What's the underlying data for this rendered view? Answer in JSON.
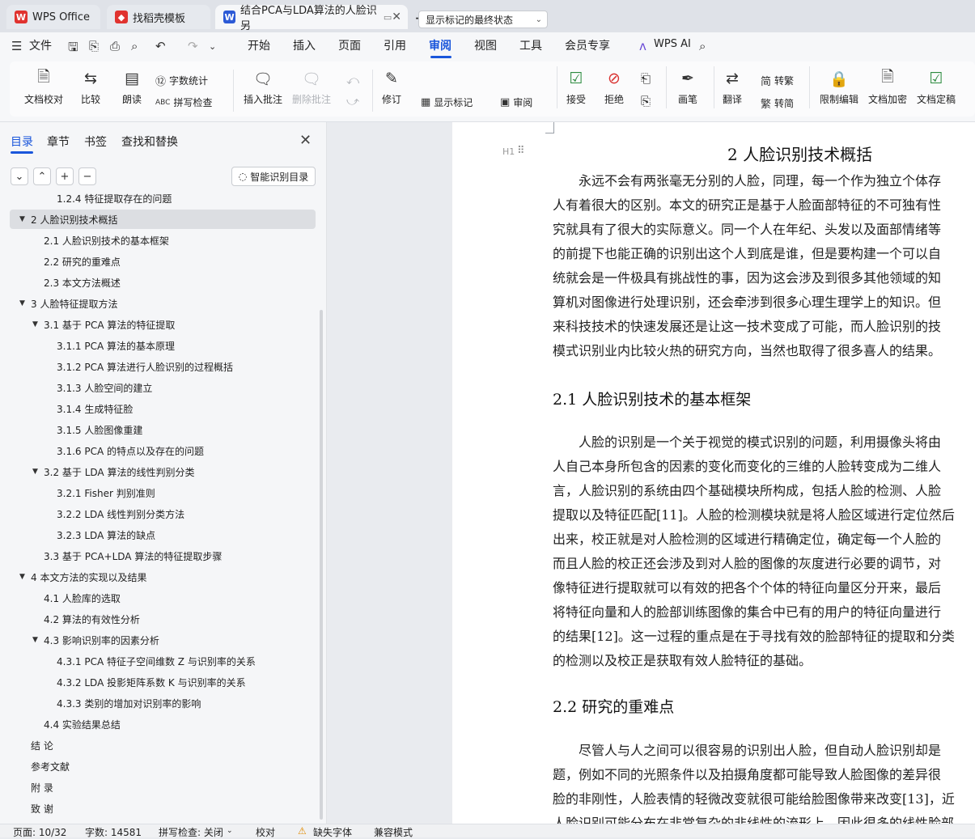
{
  "tabs": [
    {
      "label": "WPS Office",
      "icon": "wps-logo-icon",
      "color": "#e0332f"
    },
    {
      "label": "找稻壳模板",
      "icon": "docer-logo-icon",
      "color": "#e0332f"
    },
    {
      "label": "结合PCA与LDA算法的人脸识另",
      "icon": "word-doc-icon",
      "color": "#2c5ad6"
    }
  ],
  "menu": {
    "file": "文件",
    "items": [
      "开始",
      "插入",
      "页面",
      "引用",
      "审阅",
      "视图",
      "工具",
      "会员专享"
    ],
    "active": "审阅",
    "wps_ai": "WPS AI"
  },
  "ribbon": {
    "doc_check": "文档校对",
    "compare": "比较",
    "read_aloud": "朗读",
    "word_count": "字数统计",
    "spell_check": "拼写检查",
    "insert_comment": "插入批注",
    "delete_comment": "删除批注",
    "track": "修订",
    "markup_select": "显示标记的最终状态",
    "show_markup": "显示标记",
    "review_pane": "审阅",
    "accept": "接受",
    "reject": "拒绝",
    "pen": "画笔",
    "translate": "翻译",
    "to_traditional": "转繁",
    "to_simplified": "转简",
    "restrict_edit": "限制编辑",
    "doc_encrypt": "文档加密",
    "doc_finalize": "文档定稿"
  },
  "nav": {
    "tabs": [
      "目录",
      "章节",
      "书签",
      "查找和替换"
    ],
    "active_tab": "目录",
    "smart_toc": "智能识别目录",
    "toc": [
      {
        "text": "1.2.4  特征提取存在的问题",
        "level": 3,
        "caret": false
      },
      {
        "text": "2  人脸识别技术概括",
        "level": 1,
        "caret": true,
        "selected": true
      },
      {
        "text": "2.1  人脸识别技术的基本框架",
        "level": 2,
        "caret": false
      },
      {
        "text": "2.2  研究的重难点",
        "level": 2,
        "caret": false
      },
      {
        "text": "2.3  本文方法概述",
        "level": 2,
        "caret": false
      },
      {
        "text": "3  人脸特征提取方法",
        "level": 1,
        "caret": true
      },
      {
        "text": "3.1  基于 PCA 算法的特征提取",
        "level": 2,
        "caret": true
      },
      {
        "text": "3.1.1 PCA 算法的基本原理",
        "level": 3,
        "caret": false
      },
      {
        "text": "3.1.2 PCA 算法进行人脸识别的过程概括",
        "level": 3,
        "caret": false
      },
      {
        "text": "3.1.3  人脸空间的建立",
        "level": 3,
        "caret": false
      },
      {
        "text": "3.1.4  生成特征脸",
        "level": 3,
        "caret": false
      },
      {
        "text": "3.1.5  人脸图像重建",
        "level": 3,
        "caret": false
      },
      {
        "text": "3.1.6 PCA 的特点以及存在的问题",
        "level": 3,
        "caret": false
      },
      {
        "text": "3.2  基于 LDA 算法的线性判别分类",
        "level": 2,
        "caret": true
      },
      {
        "text": "3.2.1 Fisher 判别准则",
        "level": 3,
        "caret": false
      },
      {
        "text": "3.2.2 LDA 线性判别分类方法",
        "level": 3,
        "caret": false
      },
      {
        "text": "3.2.3 LDA 算法的缺点",
        "level": 3,
        "caret": false
      },
      {
        "text": "3.3  基于 PCA+LDA 算法的特征提取步骤",
        "level": 2,
        "caret": false
      },
      {
        "text": "4  本文方法的实现以及结果",
        "level": 1,
        "caret": true
      },
      {
        "text": "4.1  人脸库的选取",
        "level": 2,
        "caret": false
      },
      {
        "text": "4.2  算法的有效性分析",
        "level": 2,
        "caret": false
      },
      {
        "text": "4.3  影响识别率的因素分析",
        "level": 2,
        "caret": true
      },
      {
        "text": "4.3.1 PCA 特征子空间维数 Z 与识别率的关系",
        "level": 3,
        "caret": false
      },
      {
        "text": "4.3.2 LDA 投影矩阵系数 K 与识别率的关系",
        "level": 3,
        "caret": false
      },
      {
        "text": "4.3.3  类别的增加对识别率的影响",
        "level": 3,
        "caret": false
      },
      {
        "text": "4.4  实验结果总结",
        "level": 2,
        "caret": false
      },
      {
        "text": "结  论",
        "level": 1,
        "caret": false
      },
      {
        "text": "参考文献",
        "level": 1,
        "caret": false
      },
      {
        "text": "附  录",
        "level": 1,
        "caret": false
      },
      {
        "text": "致  谢",
        "level": 1,
        "caret": false
      }
    ]
  },
  "doc": {
    "heading_mark": "H1",
    "h1": "2  人脸识别技术概括",
    "p1": [
      "　　永远不会有两张毫无分别的人脸，同理，每一个作为独立个体存",
      "人有着很大的区别。本文的研究正是基于人脸面部特征的不可独有性",
      "究就具有了很大的实际意义。同一个人在年纪、头发以及面部情绪等",
      "的前提下也能正确的识别出这个人到底是谁，但是要构建一个可以自",
      "统就会是一件极具有挑战性的事，因为这会涉及到很多其他领域的知",
      "算机对图像进行处理识别，还会牵涉到很多心理生理学上的知识。但",
      "来科技技术的快速发展还是让这一技术变成了可能，而人脸识别的技",
      "模式识别业内比较火热的研究方向，当然也取得了很多喜人的结果。"
    ],
    "h2a": "2.1  人脸识别技术的基本框架",
    "p2": [
      "　　人脸的识别是一个关于视觉的模式识别的问题，利用摄像头将由",
      "人自己本身所包含的因素的变化而变化的三维的人脸转变成为二维人",
      "言，人脸识别的系统由四个基础模块所构成，包括人脸的检测、人脸",
      "提取以及特征匹配[11]。人脸的检测模块就是将人脸区域进行定位然后",
      "出来，校正就是对人脸检测的区域进行精确定位，确定每一个人脸的",
      "而且人脸的校正还会涉及到对人脸的图像的灰度进行必要的调节，对",
      "像特征进行提取就可以有效的把各个个体的特征向量区分开来，最后",
      "将特征向量和人的脸部训练图像的集合中已有的用户的特征向量进行",
      "的结果[12]。这一过程的重点是在于寻找有效的脸部特征的提取和分类",
      "的检测以及校正是获取有效人脸特征的基础。"
    ],
    "h2b": "2.2  研究的重难点",
    "p3": [
      "　　尽管人与人之间可以很容易的识别出人脸，但自动人脸识别却是",
      "题，例如不同的光照条件以及拍摄角度都可能导致人脸图像的差异很",
      "脸的非刚性，人脸表情的轻微改变就很可能给脸图像带来改变[13]，近",
      "人脸识别可能分布在非常复杂的非线性的流形上，因此很多的线性脸部"
    ]
  },
  "status": {
    "page": "页面: 10/32",
    "words": "字数: 14581",
    "spell": "拼写检查: 关闭",
    "proof": "校对",
    "missing_font": "缺失字体",
    "compat": "兼容模式"
  }
}
